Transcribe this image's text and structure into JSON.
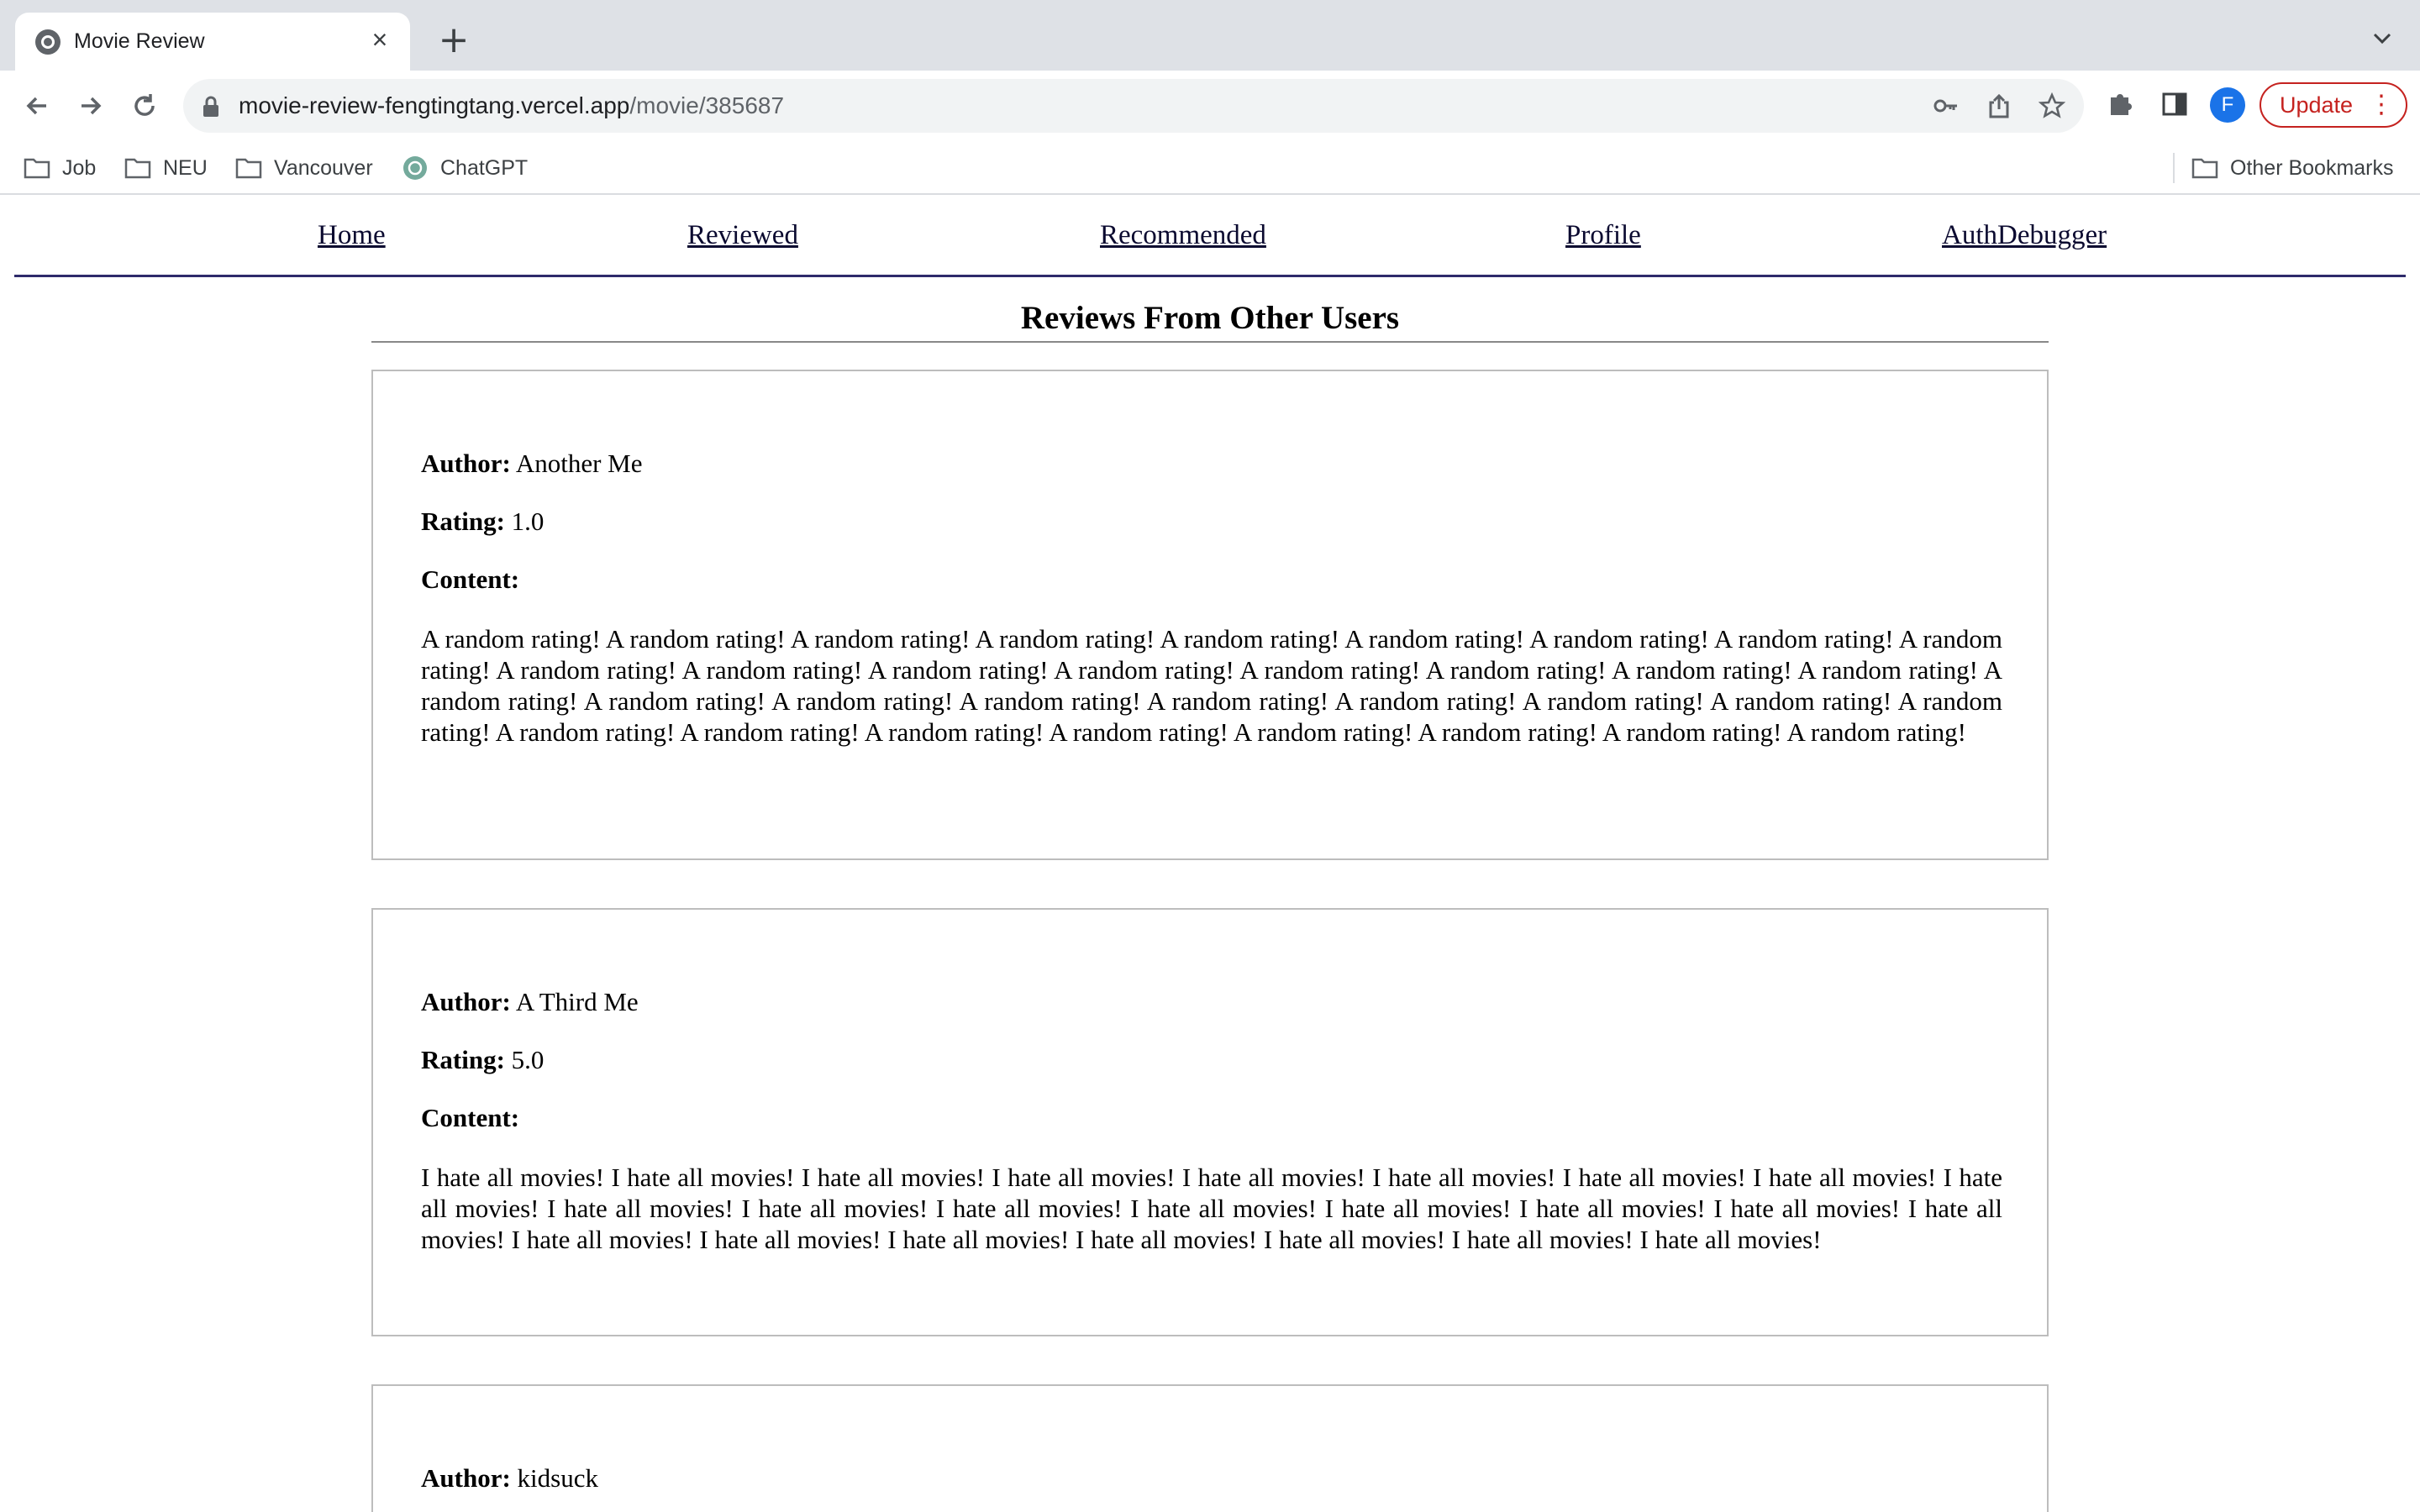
{
  "browser": {
    "tab_title": "Movie Review",
    "url_host": "movie-review-fengtingtang.vercel.app",
    "url_path": "/movie/385687",
    "profile_initial": "F",
    "update_label": "Update",
    "bookmarks": [
      "Job",
      "NEU",
      "Vancouver",
      "ChatGPT"
    ],
    "other_bookmarks": "Other Bookmarks"
  },
  "nav": {
    "home": "Home",
    "reviewed": "Reviewed",
    "recommended": "Recommended",
    "profile": "Profile",
    "auth_debugger": "AuthDebugger"
  },
  "section_title": "Reviews From Other Users",
  "labels": {
    "author": "Author:",
    "rating": "Rating:",
    "content": "Content:"
  },
  "reviews": [
    {
      "author": "Another Me",
      "rating": "1.0",
      "content": "A random rating! A random rating! A random rating! A random rating! A random rating! A random rating! A random rating! A random rating! A random rating! A random rating! A random rating! A random rating! A random rating! A random rating! A random rating! A random rating! A random rating! A random rating! A random rating! A random rating! A random rating! A random rating! A random rating! A random rating! A random rating! A random rating! A random rating! A random rating! A random rating! A random rating! A random rating! A random rating! A random rating! A random rating!"
    },
    {
      "author": "A Third Me",
      "rating": "5.0",
      "content": "I hate all movies! I hate all movies! I hate all movies! I hate all movies! I hate all movies! I hate all movies! I hate all movies! I hate all movies! I hate all movies! I hate all movies! I hate all movies! I hate all movies! I hate all movies! I hate all movies! I hate all movies! I hate all movies! I hate all movies! I hate all movies! I hate all movies! I hate all movies! I hate all movies! I hate all movies! I hate all movies! I hate all movies!"
    },
    {
      "author": "kidsuck"
    }
  ]
}
